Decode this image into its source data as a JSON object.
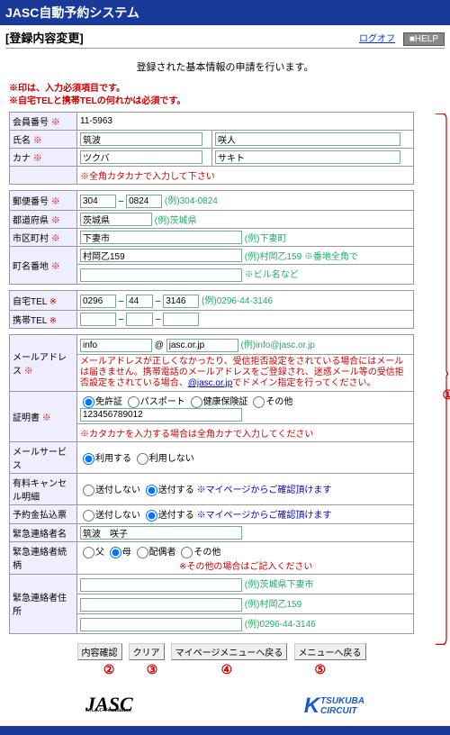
{
  "header": {
    "title": "JASC自動予約システム",
    "subtitle": "[登録内容変更]",
    "logoff": "ログオフ",
    "help": "■HELP"
  },
  "lead": "登録された基本情報の申請を行います。",
  "warnings": {
    "w1": "※印は、入力必須項目です。",
    "w2": "※自宅TELと携帯TELの何れかは必須です。"
  },
  "req_mark": "※",
  "labels": {
    "member_no": "会員番号",
    "name": "氏名",
    "kana": "カナ",
    "postal": "郵便番号",
    "pref": "都道府県",
    "city": "市区町村",
    "addr": "町名番地",
    "tel_home": "自宅TEL",
    "tel_mobile": "携帯TEL",
    "mail": "メールアドレス",
    "id_doc": "証明書",
    "mail_service": "メールサービス",
    "cancel_detail": "有料キャンセル明細",
    "prepay": "予約金払込票",
    "emerg_name": "緊急連絡者名",
    "emerg_rel": "緊急連絡者続柄",
    "emerg_addr": "緊急連絡者住所"
  },
  "values": {
    "member_no": "11-5963",
    "name_sei": "筑波",
    "name_mei": "咲人",
    "kana_sei": "ツクバ",
    "kana_mei": "サキト",
    "kana_note": "※全角カタカナで入力して下さい",
    "postal1": "304",
    "postal2": "0824",
    "postal_hint": "(例)304-0824",
    "pref": "茨城県",
    "pref_hint": "(例)茨城県",
    "city": "下妻市",
    "city_hint": "(例)下妻町",
    "addr": "村岡乙159",
    "addr_hint": "(例)村岡乙159 ※番地全角で",
    "building_hint": "※ビル名など",
    "tel1": "0296",
    "tel2": "44",
    "tel3": "3146",
    "tel_hint": "(例)0296-44-3146",
    "mail_local": "info",
    "mail_at": "@",
    "mail_domain": "jasc.or.jp",
    "mail_hint": "(例)info@jasc.or.jp",
    "mail_note1": "メールアドレスが正しくなかったり、受信拒否設定をされている場合にはメールは届きません。携帯電話のメールアドレスをご登録され、迷惑メール等の受信拒否設定をされている場合、",
    "mail_link": "@jasc.or.jp",
    "mail_note2": "でドメイン指定を行ってください。",
    "id_number": "123456789012",
    "id_note": "※カタカナを入力する場合は全角カナで入力してください",
    "emerg_name": "筑波　咲子",
    "rel_note": "※その他の場合はご記入ください",
    "emerg_pref_hint": "(例)茨城県下妻市",
    "emerg_addr_hint": "(例)村岡乙159",
    "emerg_tel_hint": "(例)0296-44-3146"
  },
  "options": {
    "id_doc": {
      "o1": "免許証",
      "o2": "パスポート",
      "o3": "健康保険証",
      "o4": "その他"
    },
    "mail_service": {
      "o1": "利用する",
      "o2": "利用しない"
    },
    "send": {
      "o1": "送付しない",
      "o2": "送付する",
      "note": "※マイページからご確認頂けます"
    },
    "rel": {
      "o1": "父",
      "o2": "母",
      "o3": "配偶者",
      "o4": "その他"
    }
  },
  "buttons": {
    "b1": "内容確認",
    "b2": "クリア",
    "b3": "マイページメニューへ戻る",
    "b4": "メニューへ戻る"
  },
  "markers": {
    "m1": "①",
    "m2": "②",
    "m3": "③",
    "m4": "④",
    "m5": "⑤"
  },
  "logos": {
    "jasc": "JASC",
    "jasc_sub": "J.A.S.C Foundation",
    "tc_k": "K",
    "tc1": "TSUKUBA",
    "tc2": "CIRCUIT"
  }
}
